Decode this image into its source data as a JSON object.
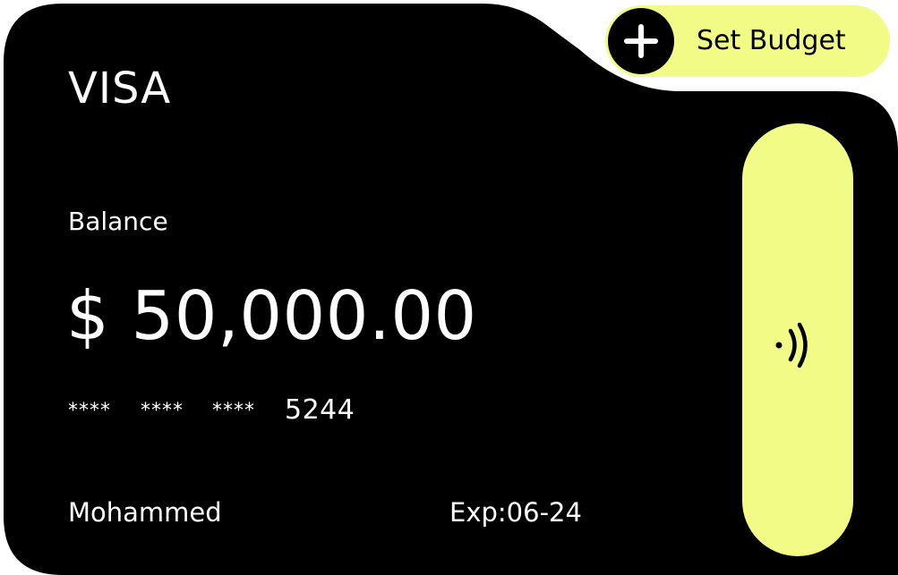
{
  "card": {
    "brand": "VISA",
    "balance_label": "Balance",
    "balance_value": "$ 50,000.00",
    "masked_groups": [
      "****",
      "****",
      "****"
    ],
    "last4": "5244",
    "holder_name": "Mohammed",
    "expiry": "Exp:06-24"
  },
  "actions": {
    "set_budget_label": "Set Budget",
    "set_budget_icon": "plus-icon",
    "contactless_icon": "contactless-icon"
  },
  "colors": {
    "card_background": "#000000",
    "accent": "#f1fb86",
    "text_primary": "#ffffff",
    "text_on_accent": "#000000"
  }
}
